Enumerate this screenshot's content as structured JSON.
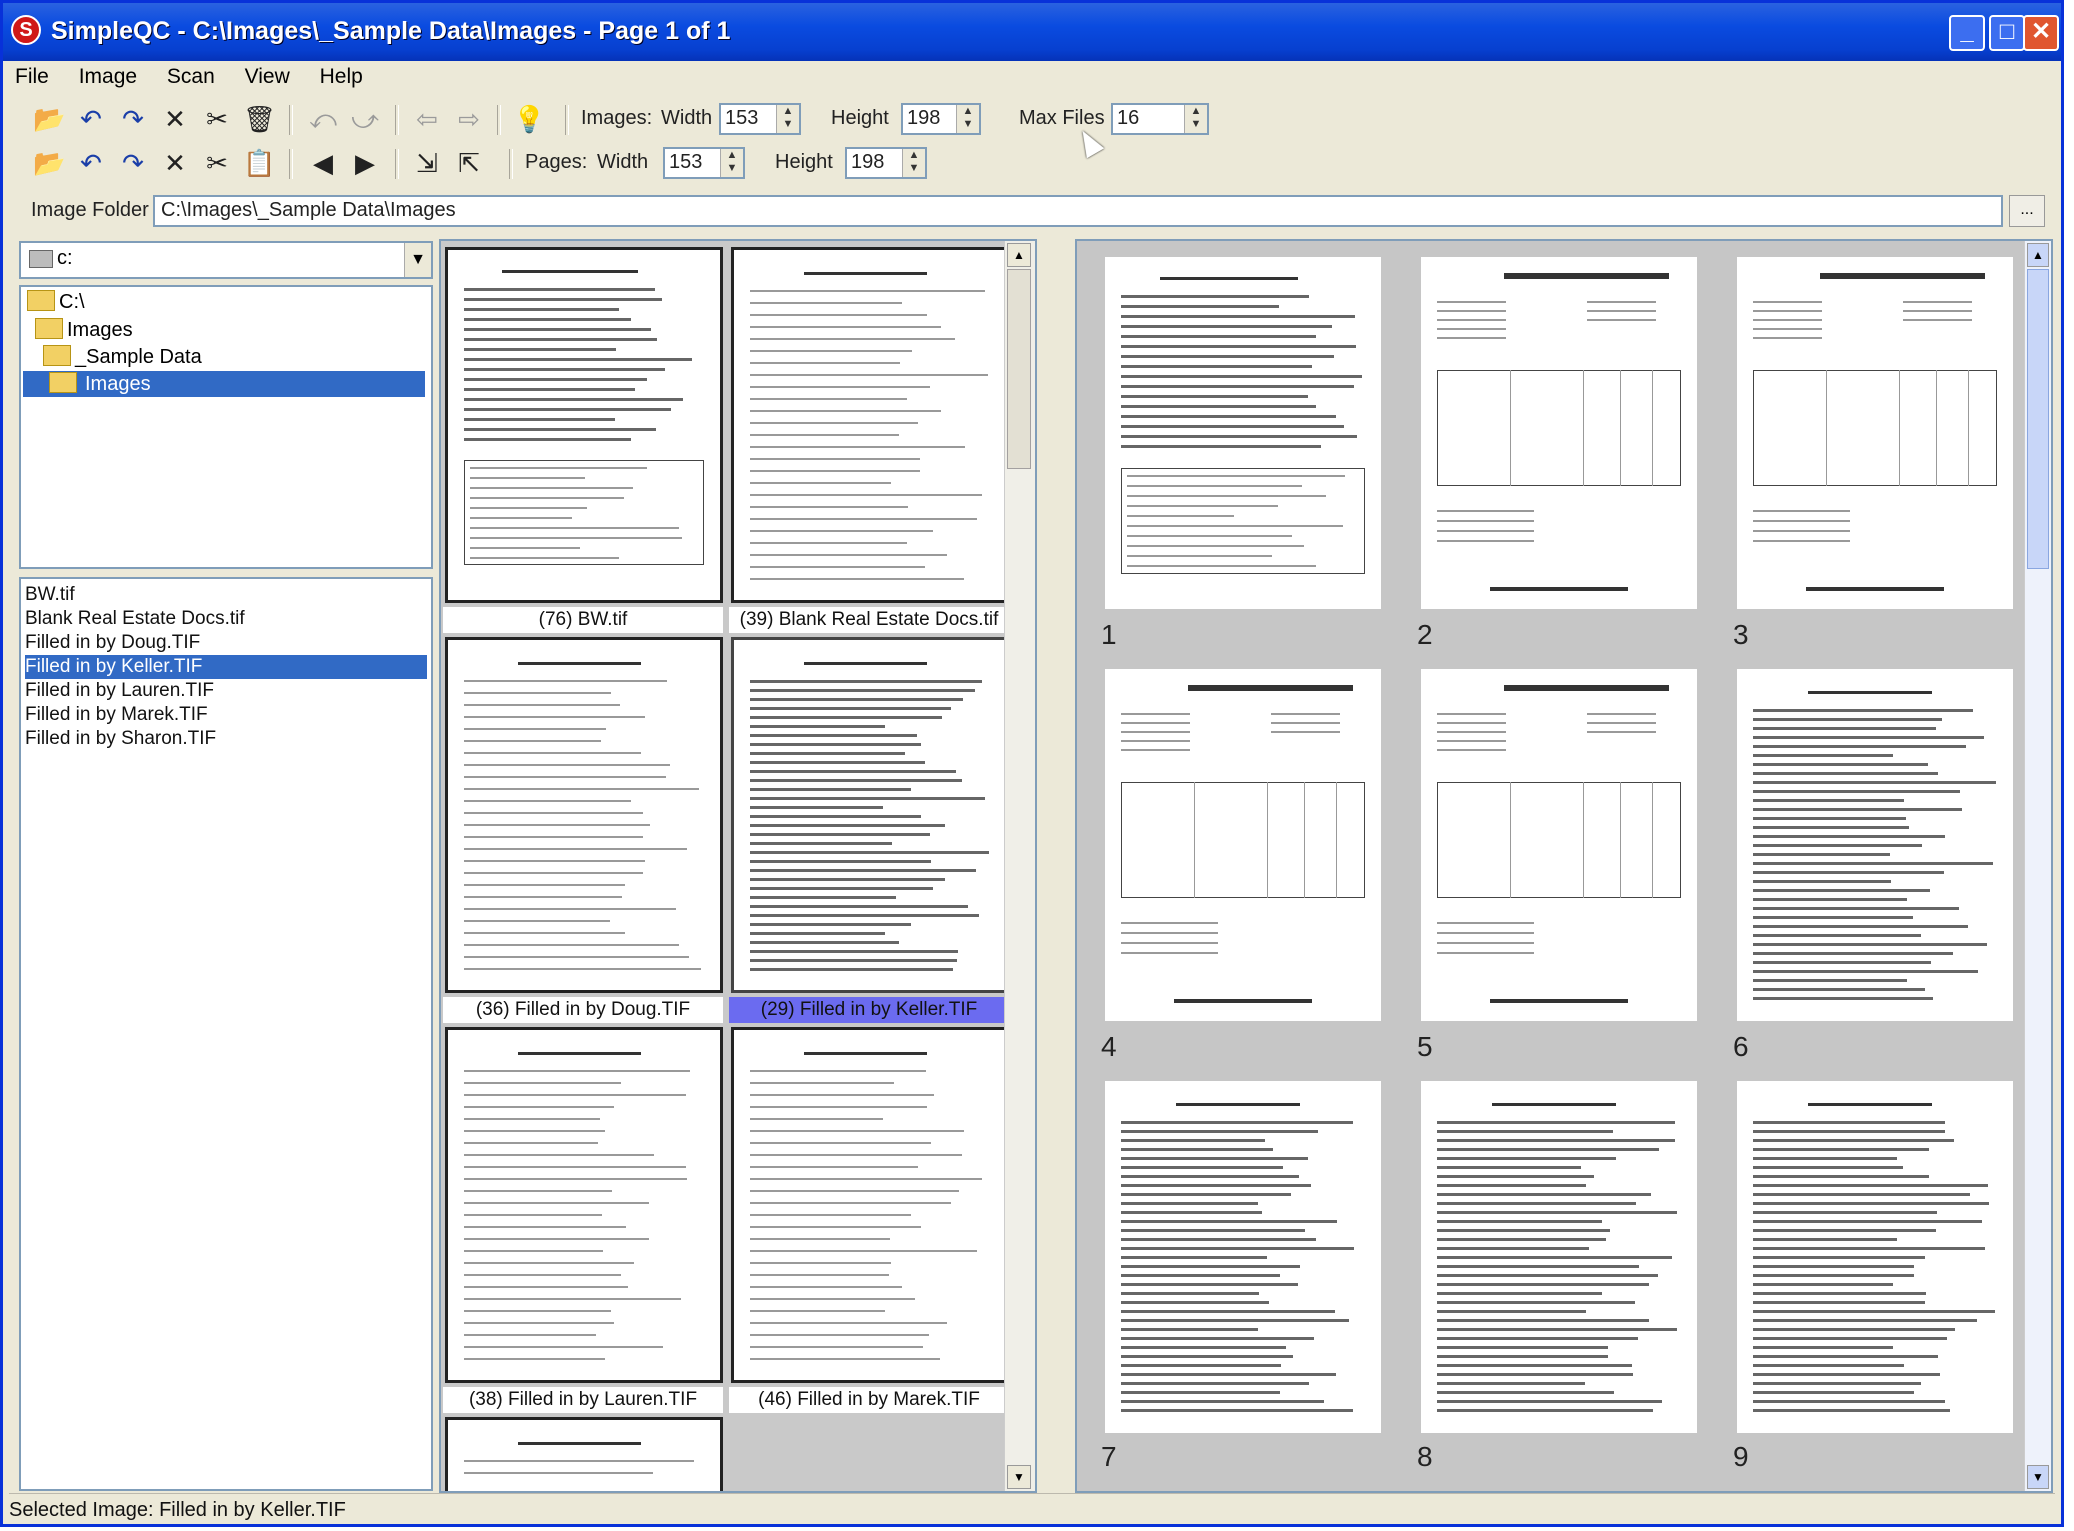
{
  "window": {
    "title": "SimpleQC - C:\\Images\\_Sample Data\\Images - Page 1 of 1",
    "app_icon_letter": "S",
    "minimize_glyph": "_",
    "maximize_glyph": "□",
    "close_glyph": "✕"
  },
  "menu": [
    "File",
    "Image",
    "Scan",
    "View",
    "Help"
  ],
  "toolbar1": {
    "images_label": "Images:",
    "width_label": "Width",
    "width_value": "153",
    "height_label": "Height",
    "height_value": "198",
    "max_files_label": "Max Files",
    "max_files_value": "16"
  },
  "toolbar2": {
    "pages_label": "Pages:",
    "width_label": "Width",
    "width_value": "153",
    "height_label": "Height",
    "height_value": "198"
  },
  "image_folder": {
    "label": "Image Folder",
    "value": "C:\\Images\\_Sample Data\\Images",
    "browse_label": "..."
  },
  "drive": {
    "value": "c:"
  },
  "tree": [
    "C:\\",
    "Images",
    "_Sample Data",
    "Images"
  ],
  "files": [
    "BW.tif",
    "Blank Real Estate Docs.tif",
    "Filled in by Doug.TIF",
    "Filled in by Keller.TIF",
    "Filled in by Lauren.TIF",
    "Filled in by Marek.TIF",
    "Filled in by Sharon.TIF"
  ],
  "selected_file_index": 3,
  "middle_thumbnails": [
    {
      "caption": "(76) BW.tif"
    },
    {
      "caption": "(39) Blank Real Estate Docs.tif"
    },
    {
      "caption": "(36) Filled in by Doug.TIF"
    },
    {
      "caption": "(29) Filled in by Keller.TIF"
    },
    {
      "caption": "(38) Filled in by Lauren.TIF"
    },
    {
      "caption": "(46) Filled in by Marek.TIF"
    }
  ],
  "pages": [
    "1",
    "2",
    "3",
    "4",
    "5",
    "6",
    "7",
    "8",
    "9"
  ],
  "status": "Selected Image: Filled in by Keller.TIF",
  "icons": {
    "toolbar1": [
      "open-folder-icon",
      "undo-icon",
      "redo-icon",
      "delete-icon",
      "cut-icon",
      "trash-icon",
      "rotate-left-icon",
      "rotate-right-icon",
      "back-arrow-icon",
      "forward-arrow-icon",
      "help-bulb-icon"
    ],
    "toolbar2": [
      "open-pages-icon",
      "undo-page-icon",
      "redo-page-icon",
      "delete-page-icon",
      "cut-page-icon",
      "paste-page-icon",
      "move-left-icon",
      "move-right-icon",
      "split-icon",
      "merge-icon"
    ]
  },
  "colors": {
    "titlebar": "#0a4be0",
    "selection": "#316ac5",
    "chrome": "#ece9d8",
    "caption_selected": "#6b6bf0"
  }
}
